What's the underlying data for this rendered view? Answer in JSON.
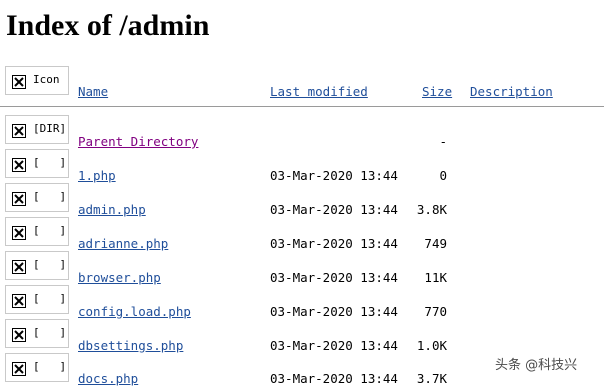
{
  "page": {
    "title": "Index of /admin"
  },
  "header": {
    "icon_alt": "Icon",
    "name": "Name",
    "last_modified": "Last modified",
    "size": "Size",
    "description": "Description"
  },
  "rows": [
    {
      "alt": "[DIR]",
      "name": "Parent Directory",
      "modified": "",
      "size": "-"
    },
    {
      "alt": "[   ]",
      "name": "1.php",
      "modified": "03-Mar-2020 13:44",
      "size": "0"
    },
    {
      "alt": "[   ]",
      "name": "admin.php",
      "modified": "03-Mar-2020 13:44",
      "size": "3.8K"
    },
    {
      "alt": "[   ]",
      "name": "adrianne.php",
      "modified": "03-Mar-2020 13:44",
      "size": "749"
    },
    {
      "alt": "[   ]",
      "name": "browser.php",
      "modified": "03-Mar-2020 13:44",
      "size": "11K"
    },
    {
      "alt": "[   ]",
      "name": "config.load.php",
      "modified": "03-Mar-2020 13:44",
      "size": "770"
    },
    {
      "alt": "[   ]",
      "name": "dbsettings.php",
      "modified": "03-Mar-2020 13:44",
      "size": "1.0K"
    },
    {
      "alt": "[   ]",
      "name": "docs.php",
      "modified": "03-Mar-2020 13:44",
      "size": "3.7K"
    }
  ],
  "watermark": "头条 @科技兴"
}
